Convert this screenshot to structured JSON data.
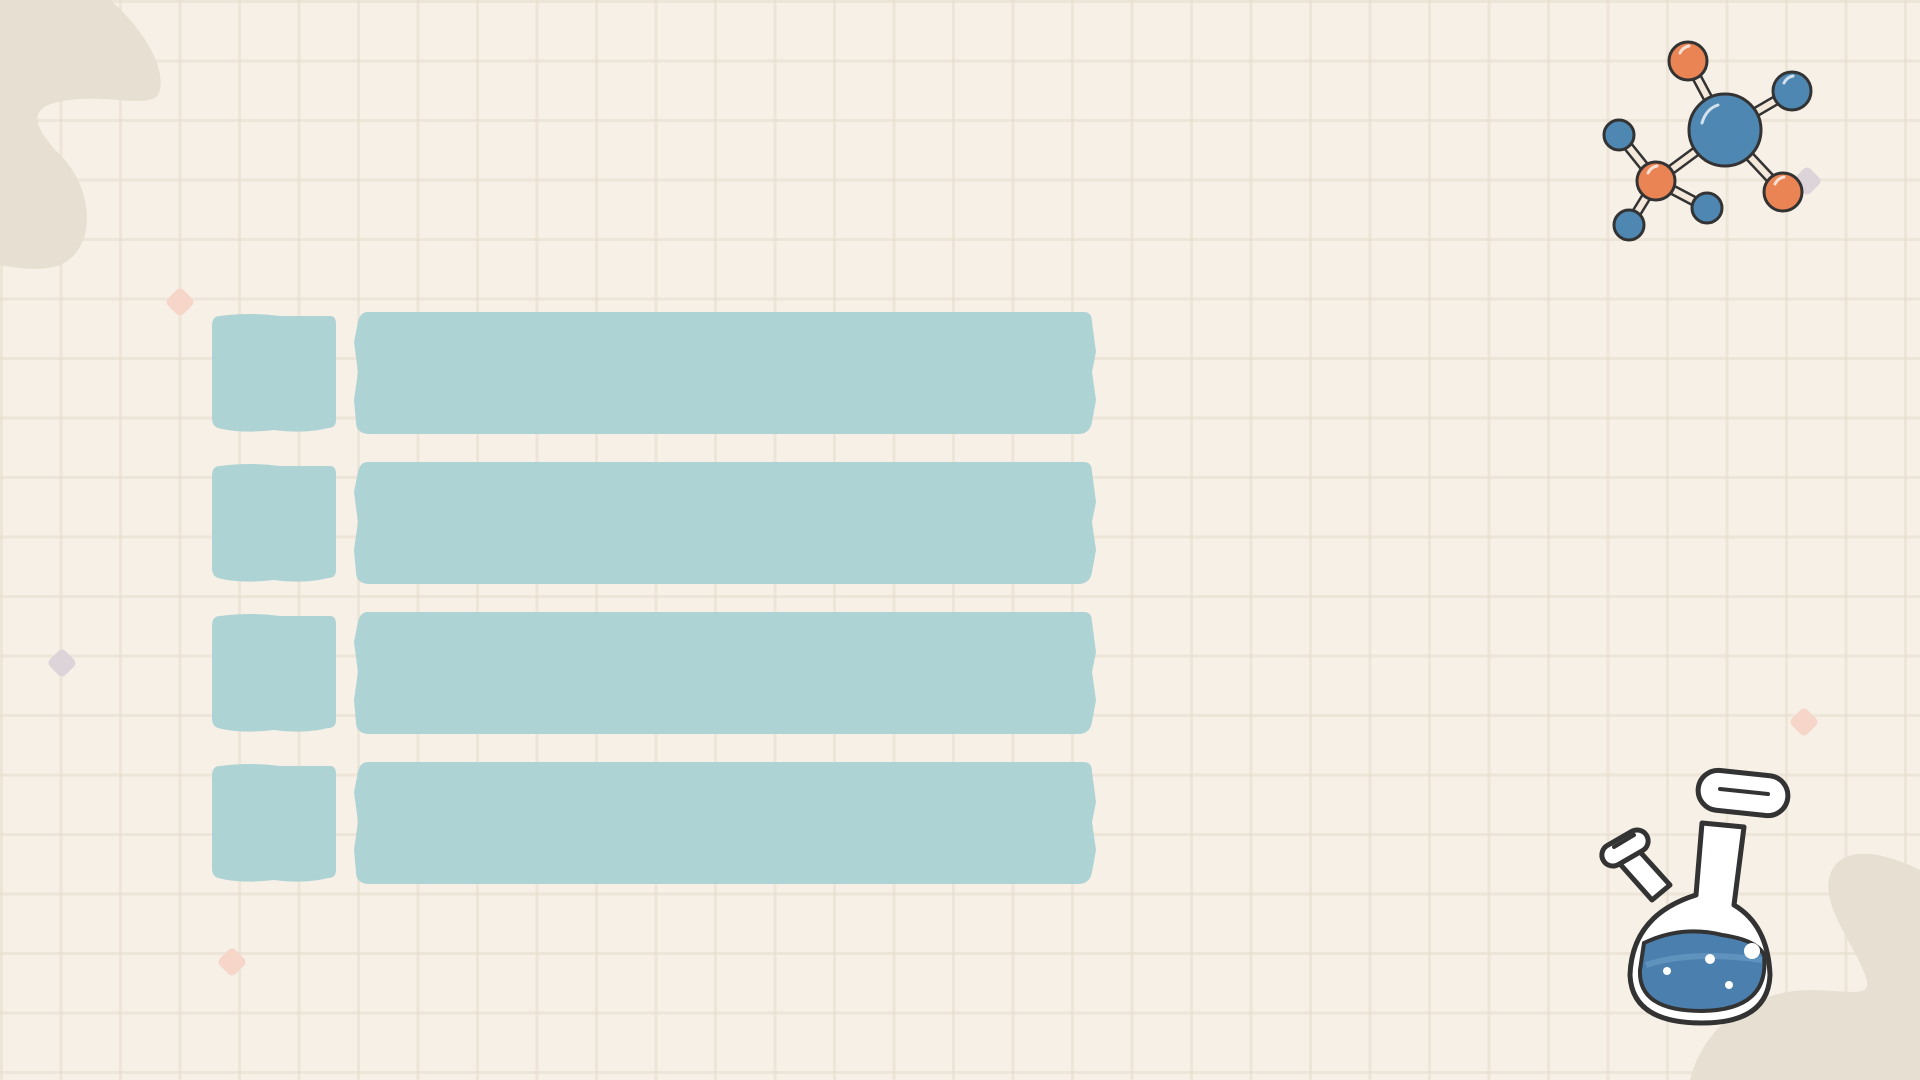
{
  "theme": {
    "background": "#f7f0e6",
    "grid_line": "#e6dccd",
    "blob": "#e7dfd1",
    "box_fill": "#aed3d4",
    "molecule_blue": "#4f87b3",
    "molecule_orange": "#ea8454",
    "flask_liquid": "#4a7fae",
    "outline": "#333333",
    "sparkle_pink": "#f6d6c9",
    "sparkle_lilac": "#ddd4da"
  },
  "table_rows": [
    {
      "number": "",
      "text": ""
    },
    {
      "number": "",
      "text": ""
    },
    {
      "number": "",
      "text": ""
    },
    {
      "number": "",
      "text": ""
    }
  ],
  "decorations": {
    "top_right": "molecule-icon",
    "bottom_right": "flask-icon"
  }
}
